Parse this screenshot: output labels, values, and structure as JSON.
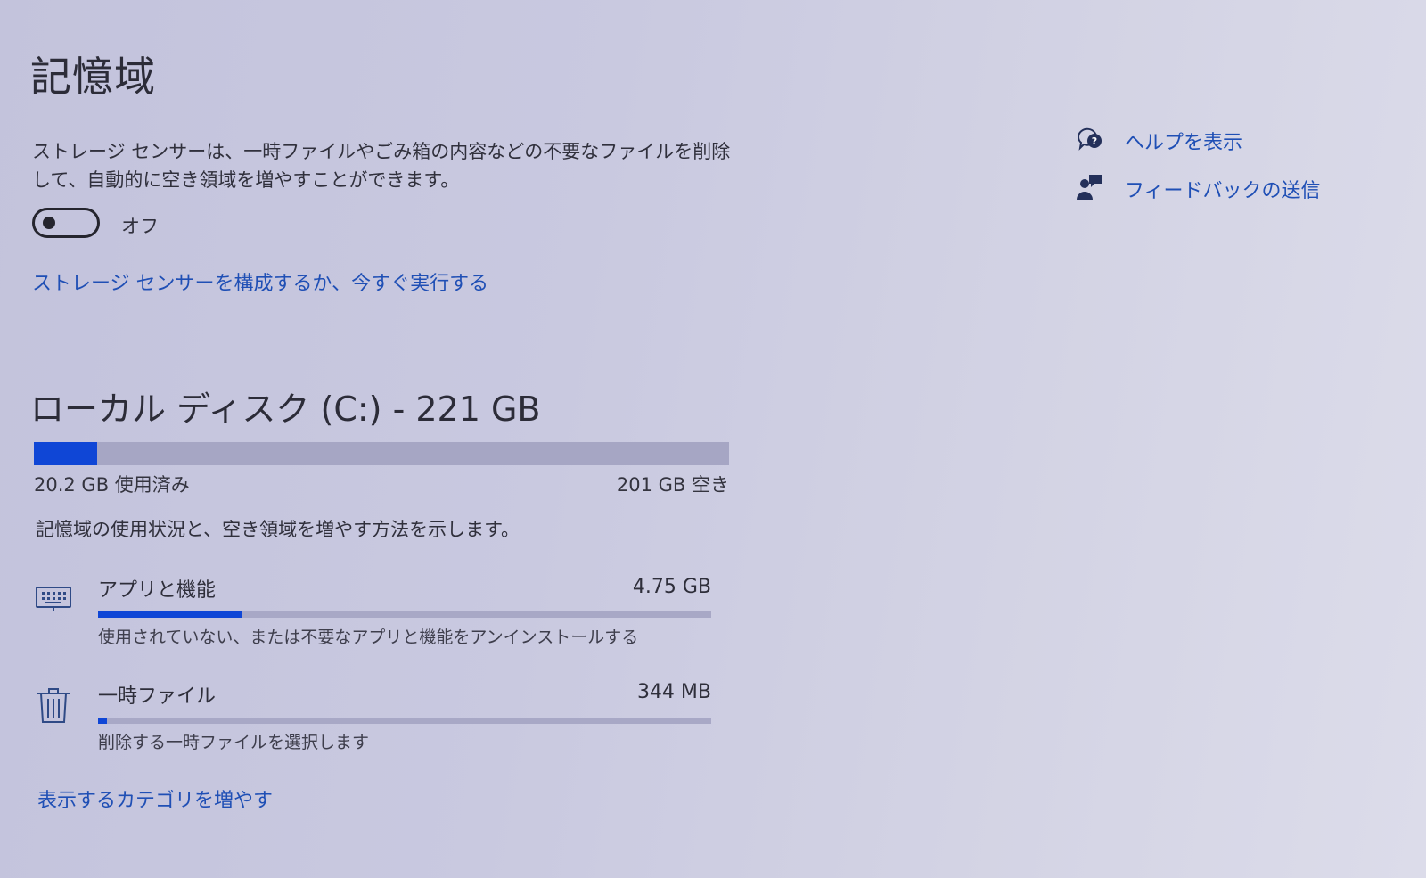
{
  "page": {
    "title": "記憶域",
    "description": "ストレージ センサーは、一時ファイルやごみ箱の内容などの不要なファイルを削除して、自動的に空き領域を増やすことができます。"
  },
  "storage_sense": {
    "toggle_state": "off",
    "toggle_label": "オフ",
    "configure_link": "ストレージ センサーを構成するか、今すぐ実行する"
  },
  "disk": {
    "title": "ローカル ディスク (C:) - 221 GB",
    "used_label": "20.2 GB 使用済み",
    "free_label": "201 GB 空き",
    "used_fraction": 0.091,
    "description": "記憶域の使用状況と、空き領域を増やす方法を示します。"
  },
  "categories": [
    {
      "icon": "keyboard-icon",
      "title": "アプリと機能",
      "size": "4.75 GB",
      "fraction": 0.235,
      "subtitle": "使用されていない、または不要なアプリと機能をアンインストールする"
    },
    {
      "icon": "trash-icon",
      "title": "一時ファイル",
      "size": "344 MB",
      "fraction": 0.014,
      "subtitle": "削除する一時ファイルを選択します"
    }
  ],
  "more_categories_link": "表示するカテゴリを増やす",
  "side": {
    "help": {
      "icon": "help-chat-icon",
      "label": "ヘルプを表示"
    },
    "feedback": {
      "icon": "feedback-person-icon",
      "label": "フィードバックの送信"
    }
  },
  "colors": {
    "accent": "#0f46d6",
    "link": "#1f4fb5",
    "bar_track": "#a6a6c4"
  }
}
